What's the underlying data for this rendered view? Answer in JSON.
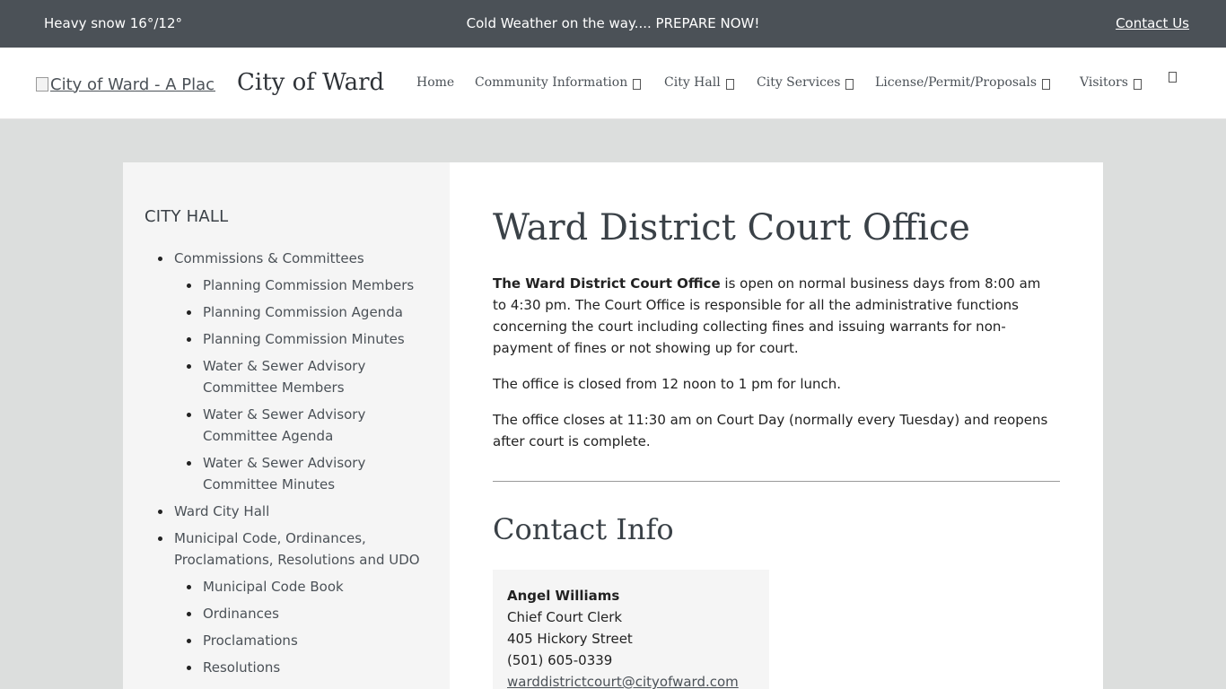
{
  "topbar": {
    "weather": "Heavy snow 16°/12°",
    "alert": "Cold Weather on the way.... PREPARE NOW!",
    "contact_label": "Contact Us"
  },
  "header": {
    "logo_alt": "City of Ward - A Place to Call Home",
    "site_name": "City of Ward",
    "nav": [
      {
        "label": "Home"
      },
      {
        "label": "Community Information"
      },
      {
        "label": "City Hall"
      },
      {
        "label": "City Services"
      },
      {
        "label": "License/Permit/Proposals"
      },
      {
        "label": "Visitors"
      }
    ]
  },
  "sidebar": {
    "heading": "CITY HALL",
    "items": [
      {
        "label": "Commissions & Committees"
      },
      {
        "label": "Planning Commission Members"
      },
      {
        "label": "Planning Commission Agenda"
      },
      {
        "label": "Planning Commission Minutes"
      },
      {
        "label": "Water & Sewer Advisory Committee Members"
      },
      {
        "label": "Water & Sewer Advisory Committee Agenda"
      },
      {
        "label": "Water & Sewer Advisory Committee Minutes"
      },
      {
        "label": "Ward City Hall"
      },
      {
        "label": "Municipal Code, Ordinances, Proclamations, Resolutions and UDO"
      },
      {
        "label": "Municipal Code Book"
      },
      {
        "label": "Ordinances"
      },
      {
        "label": "Proclamations"
      },
      {
        "label": "Resolutions"
      }
    ]
  },
  "main": {
    "title": "Ward District Court Office",
    "p1_bold": "The Ward District Court Office",
    "p1_rest": " is open on normal business days from 8:00 am to 4:30 pm.   The Court Office is responsible for all the administrative functions concerning the court including collecting fines and issuing warrants for non-payment of fines or not showing up for court.",
    "p2": "The office is closed from 12 noon to 1 pm for lunch.",
    "p3": "The office closes at 11:30 am on Court Day (normally every Tuesday) and reopens after court is complete.",
    "contact_heading": "Contact Info",
    "contact": {
      "name": "Angel Williams",
      "role": "Chief Court Clerk",
      "address": "405 Hickory Street",
      "phone": "(501) 605-0339",
      "email": "warddistrictcourt@cityofward.com"
    }
  }
}
